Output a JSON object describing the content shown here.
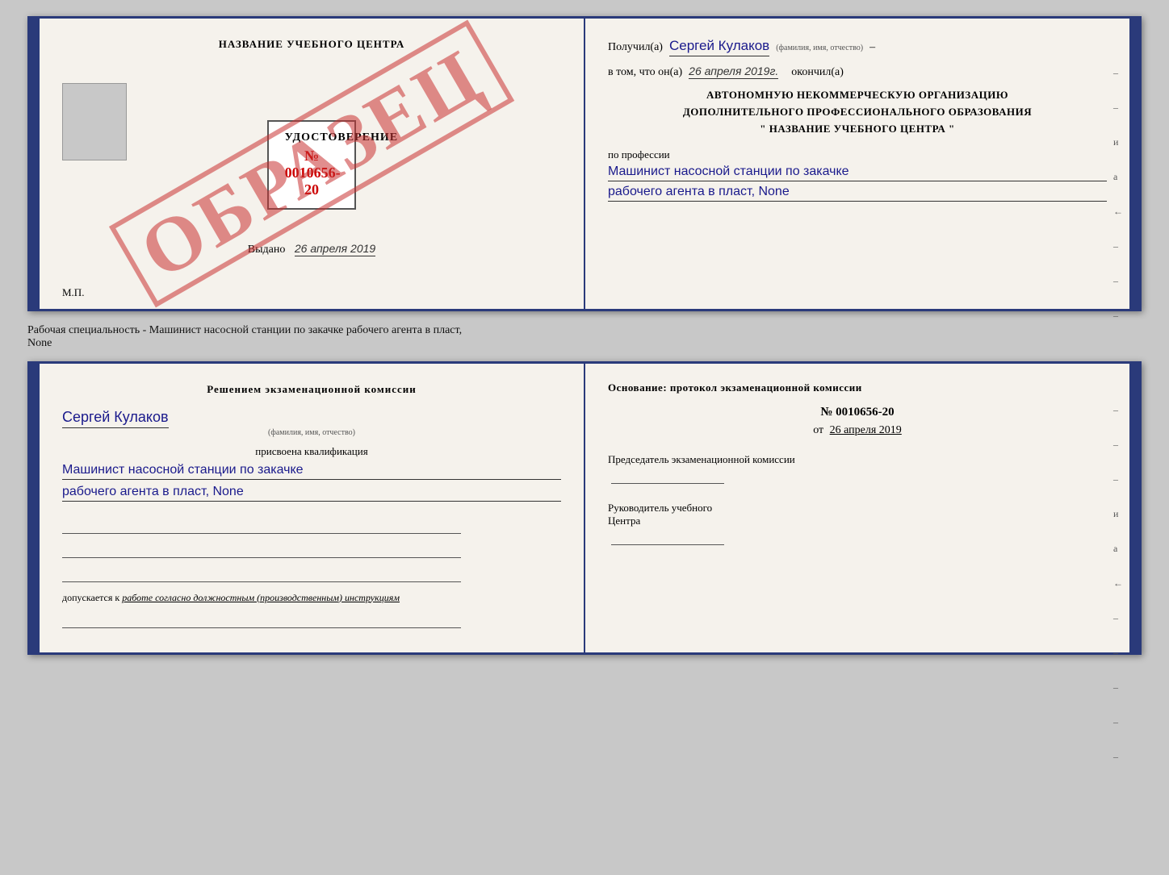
{
  "top_left": {
    "center_title": "НАЗВАНИЕ УЧЕБНОГО ЦЕНТРА",
    "watermark": "ОБРАЗЕЦ",
    "udostoverenie_title": "УДОСТОВЕРЕНИЕ",
    "udostoverenie_number": "№ 0010656-20",
    "issued_label": "Выдано",
    "issued_date": "26 апреля 2019",
    "mp_label": "М.П."
  },
  "top_right": {
    "poluchil_label": "Получил(а)",
    "recipient_name": "Сергей Кулаков",
    "famil_label": "(фамилия, имя, отчество)",
    "v_tom_label": "в том, что он(а)",
    "date_value": "26 апреля 2019г.",
    "okonchil_label": "окончил(а)",
    "org_line1": "АВТОНОМНУЮ НЕКОММЕРЧЕСКУЮ ОРГАНИЗАЦИЮ",
    "org_line2": "ДОПОЛНИТЕЛЬНОГО ПРОФЕССИОНАЛЬНОГО ОБРАЗОВАНИЯ",
    "org_line3": "\"   НАЗВАНИЕ УЧЕБНОГО ЦЕНТРА   \"",
    "po_professii_label": "по профессии",
    "profession_line1": "Машинист насосной станции по закачке",
    "profession_line2": "рабочего агента в пласт, None",
    "markers": [
      "–",
      "–",
      "и",
      "а",
      "←",
      "–",
      "–",
      "–"
    ]
  },
  "middle_text": "Рабочая специальность - Машинист насосной станции по закачке рабочего агента в пласт,",
  "middle_text2": "None",
  "bottom_left": {
    "decision_title": "Решением экзаменационной комиссии",
    "name_hw": "Сергей Кулаков",
    "name_sublabel": "(фамилия, имя, отчество)",
    "assigned_label": "присвоена квалификация",
    "profession_line1": "Машинист насосной станции по закачке",
    "profession_line2": "рабочего агента в пласт, None",
    "допускается_label": "допускается к",
    "допускается_value": "работе согласно должностным (производственным) инструкциям"
  },
  "bottom_right": {
    "osnov_title": "Основание: протокол экзаменационной комиссии",
    "number_label": "№ 0010656-20",
    "ot_label": "от",
    "date_value": "26 апреля 2019",
    "predsedatel_label": "Председатель экзаменационной комиссии",
    "rukovoditel_label": "Руководитель учебного",
    "centra_label": "Центра",
    "markers": [
      "–",
      "–",
      "–",
      "и",
      "а",
      "←",
      "–",
      "–",
      "–",
      "–",
      "–"
    ]
  }
}
